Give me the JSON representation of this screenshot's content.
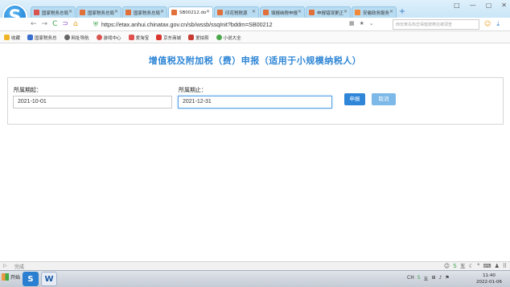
{
  "browser": {
    "logo_letter": "S",
    "tabs": [
      {
        "label": "国家税务总局",
        "color": "#d9534f",
        "active": false
      },
      {
        "label": "国家税务总局",
        "color": "#e0703a",
        "active": false
      },
      {
        "label": "国家税务总局",
        "color": "#e0703a",
        "active": false
      },
      {
        "label": "SB00212.do",
        "color": "#e0703a",
        "active": true
      },
      {
        "label": "印花税税源",
        "color": "#e0703a",
        "active": false
      },
      {
        "label": "填报纳税申报",
        "color": "#e0703a",
        "active": false
      },
      {
        "label": "申报错误更正",
        "color": "#e0703a",
        "active": false
      },
      {
        "label": "安徽政务服务",
        "color": "#ef8a3a",
        "active": false
      }
    ],
    "new_tab": "+",
    "window_controls": [
      "□",
      "—",
      "▢",
      "✕"
    ],
    "nav": {
      "back": "←",
      "forward": "→",
      "refresh": "C",
      "undo": "⊃",
      "home": "⌂"
    },
    "url": "https://etax.anhui.chinatax.gov.cn/sb/wssb/ssqInit?bddm=SB00212",
    "search_placeholder": "西安黄岛热恋保健按摩店被调查",
    "bookmarks": [
      {
        "label": "收藏",
        "color": "#f0b429"
      },
      {
        "label": "国家税务总",
        "color": "#3a6fd0"
      },
      {
        "label": "网址导航",
        "color": "#666666"
      },
      {
        "label": "游戏中心",
        "color": "#d9534f"
      },
      {
        "label": "爱淘宝",
        "color": "#e05050"
      },
      {
        "label": "京东商城",
        "color": "#d9362f"
      },
      {
        "label": "爱拍剪",
        "color": "#c93a32"
      },
      {
        "label": "小说大全",
        "color": "#4aa84a"
      }
    ]
  },
  "page": {
    "title": "增值税及附加税（费）申报（适用于小规模纳税人）",
    "period_start_label": "所属期起：",
    "period_start_value": "2021-10-01",
    "period_end_label": "所属期止：",
    "period_end_value": "2021-12-31",
    "submit_label": "申报",
    "cancel_label": "取消",
    "primary_color": "#2f86d8",
    "title_color": "#2e86d6"
  },
  "status": {
    "text": "完成"
  },
  "taskbar": {
    "start_label": "开始",
    "clock_time": "11:40",
    "clock_date": "2022-01-06"
  }
}
